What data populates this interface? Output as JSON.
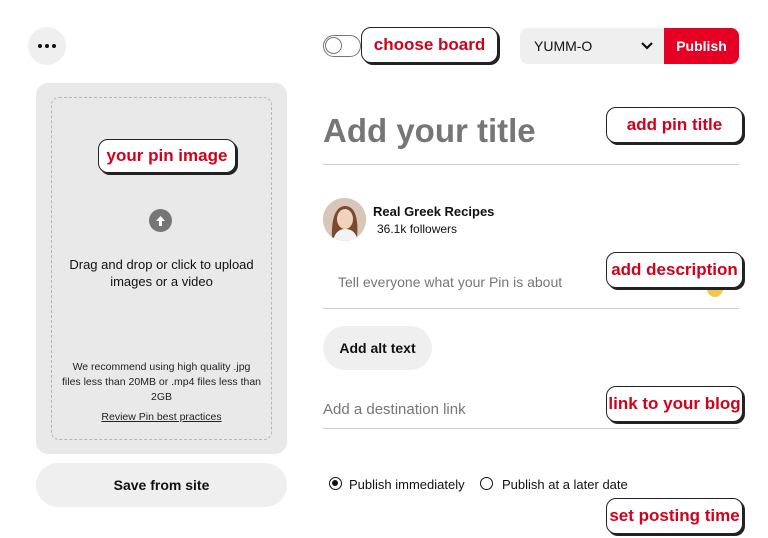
{
  "header": {
    "board_value": "YUMM-O",
    "publish_label": "Publish"
  },
  "upload": {
    "instruction": "Drag and drop or click to upload images or a video",
    "recommendation": "We recommend using high quality .jpg files less than 20MB or .mp4 files less than 2GB",
    "review_link": "Review Pin best practices",
    "save_from_site": "Save from site"
  },
  "form": {
    "title_placeholder": "Add your title",
    "profile_name": "Real Greek Recipes",
    "profile_followers": "36.1k followers",
    "description_placeholder": "Tell everyone what your Pin is about",
    "alt_text_label": "Add alt text",
    "link_placeholder": "Add a destination link",
    "publish_options": [
      {
        "label": "Publish immediately",
        "checked": true
      },
      {
        "label": "Publish at a later date",
        "checked": false
      }
    ]
  },
  "annotations": {
    "your_pin_image": "your pin image",
    "choose_board": "choose board",
    "add_pin_title": "add  pin title",
    "add_description": "add description",
    "link_to_blog": "link to your blog",
    "set_posting_time": "set posting time"
  },
  "colors": {
    "accent": "#e60023",
    "annotation_text": "#d0021b"
  }
}
